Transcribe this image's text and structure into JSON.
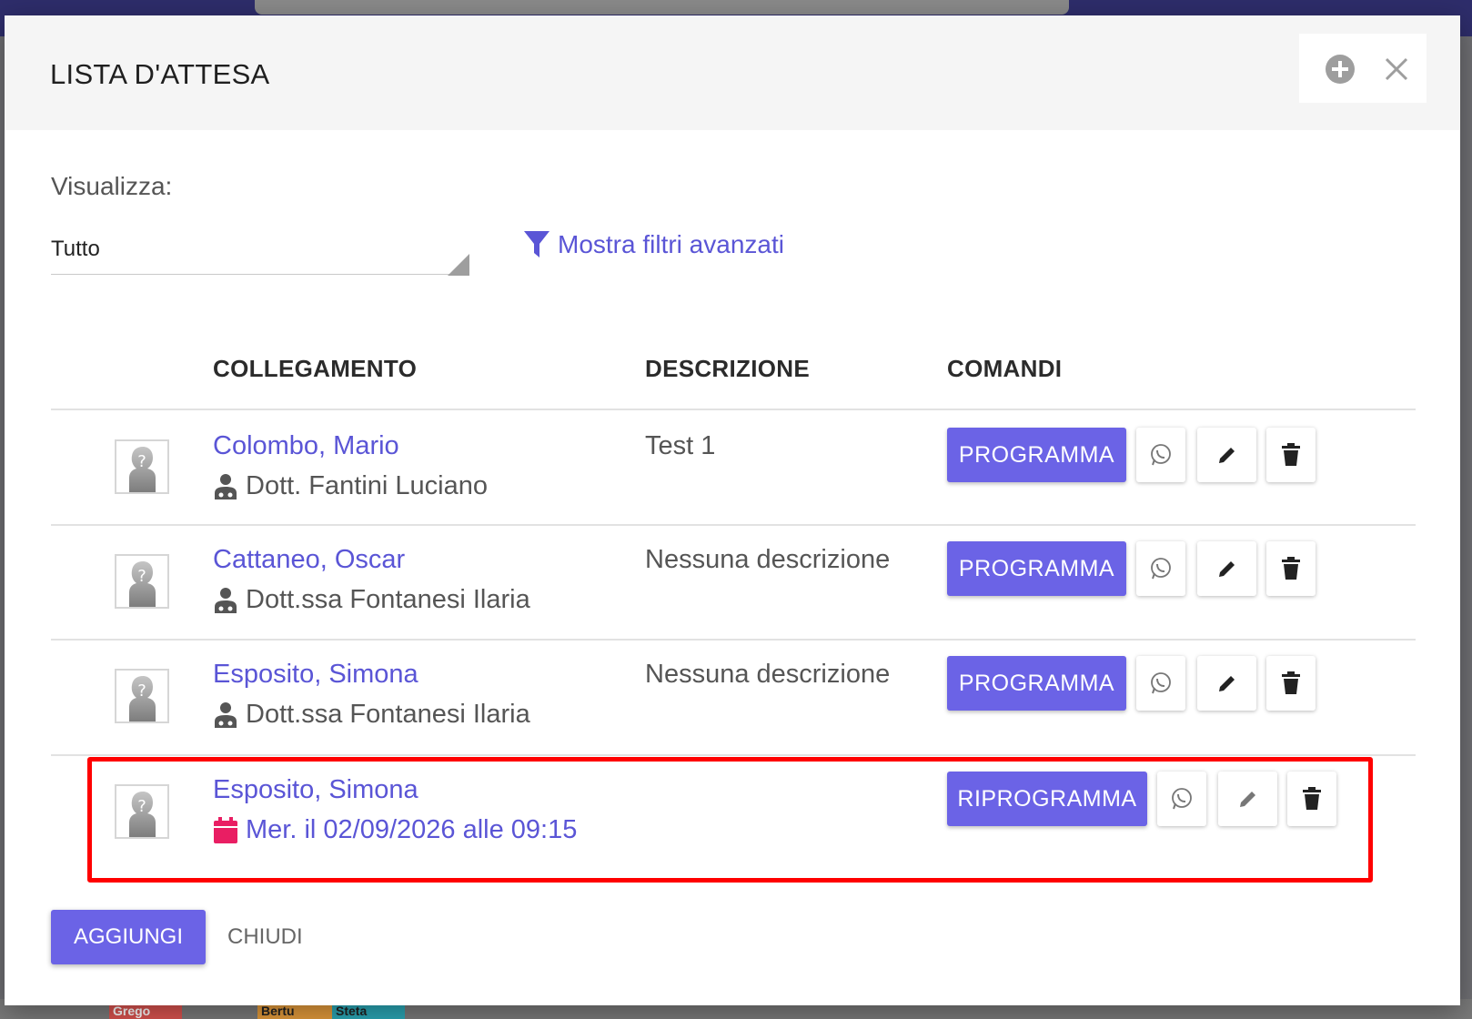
{
  "modal": {
    "title": "LISTA D'ATTESA"
  },
  "view": {
    "label": "Visualizza:",
    "selected": "Tutto"
  },
  "filter_link": "Mostra filtri avanzati",
  "table": {
    "headers": [
      "COLLEGAMENTO",
      "DESCRIZIONE",
      "COMANDI"
    ],
    "rows": [
      {
        "name": "Colombo, Mario",
        "sub": "Dott. Fantini Luciano",
        "desc": "Test 1",
        "action": "PROGRAMMA"
      },
      {
        "name": "Cattaneo, Oscar",
        "sub": "Dott.ssa Fontanesi Ilaria",
        "desc": "Nessuna descrizione",
        "action": "PROGRAMMA"
      },
      {
        "name": "Esposito, Simona",
        "sub": "Dott.ssa Fontanesi Ilaria",
        "desc": "Nessuna descrizione",
        "action": "PROGRAMMA"
      },
      {
        "name": "Esposito, Simona",
        "sub": "Mer. il 02/09/2026 alle 09:15",
        "desc": "",
        "action": "RIPROGRAMMA"
      }
    ]
  },
  "footer": {
    "add_label": "AGGIUNGI",
    "close_label": "CHIUDI"
  },
  "background_chips": [
    "Grego",
    "Bertu",
    "Steta"
  ],
  "colors": {
    "accent": "#6b63e6",
    "link": "#5a55d6",
    "calendar": "#e91e63",
    "highlight": "#ff0000"
  },
  "icons": [
    "plus-circle-icon",
    "close-icon",
    "filter-icon",
    "doctor-icon",
    "calendar-icon",
    "whatsapp-icon",
    "pencil-icon",
    "trash-icon",
    "avatar-placeholder-icon"
  ]
}
